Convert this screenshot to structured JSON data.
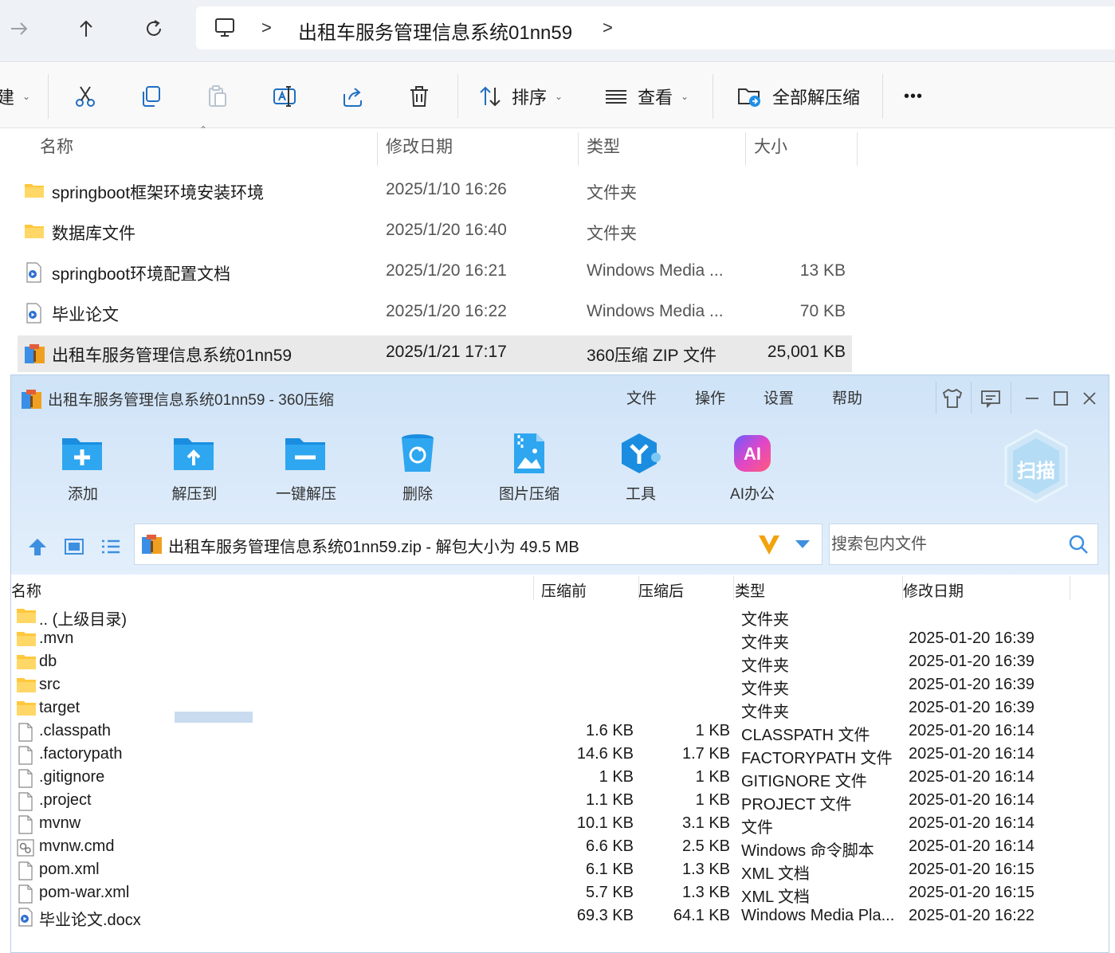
{
  "explorer": {
    "address": {
      "path": "出租车服务管理信息系统01nn59",
      "separator": ">"
    },
    "toolbar": {
      "new_fragment": "建",
      "sort_label": "排序",
      "view_label": "查看",
      "extract_all_label": "全部解压缩",
      "more_label": "•••"
    },
    "columns": {
      "name": "名称",
      "modified": "修改日期",
      "type": "类型",
      "size": "大小"
    },
    "files": [
      {
        "name": "springboot框架环境安装环境",
        "modified": "2025/1/10 16:26",
        "type": "文件夹",
        "size": "",
        "icon": "folder-icon"
      },
      {
        "name": "数据库文件",
        "modified": "2025/1/20 16:40",
        "type": "文件夹",
        "size": "",
        "icon": "folder-icon"
      },
      {
        "name": "springboot环境配置文档",
        "modified": "2025/1/20 16:21",
        "type": "Windows Media ...",
        "size": "13 KB",
        "icon": "media-doc-icon"
      },
      {
        "name": "毕业论文",
        "modified": "2025/1/20 16:22",
        "type": "Windows Media ...",
        "size": "70 KB",
        "icon": "media-doc-icon"
      },
      {
        "name": "出租车服务管理信息系统01nn59",
        "modified": "2025/1/21 17:17",
        "type": "360压缩 ZIP 文件",
        "size": "25,001 KB",
        "icon": "zip-archive-icon",
        "selected": true
      }
    ]
  },
  "zip_window": {
    "title": "出租车服务管理信息系统01nn59 - 360压缩",
    "menu": [
      "文件",
      "操作",
      "设置",
      "帮助"
    ],
    "tools": [
      {
        "label": "添加",
        "icon": "add-folder-icon"
      },
      {
        "label": "解压到",
        "icon": "extract-to-folder-icon"
      },
      {
        "label": "一键解压",
        "icon": "one-click-extract-icon"
      },
      {
        "label": "删除",
        "icon": "recycle-bin-icon"
      },
      {
        "label": "图片压缩",
        "icon": "image-compress-icon"
      },
      {
        "label": "工具",
        "icon": "tools-icon"
      },
      {
        "label": "AI办公",
        "icon": "ai-office-icon"
      }
    ],
    "scan_label": "扫描",
    "path_text": "出租车服务管理信息系统01nn59.zip - 解包大小为 49.5 MB",
    "search_placeholder": "搜索包内文件",
    "columns": {
      "name": "名称",
      "before": "压缩前",
      "after": "压缩后",
      "type": "类型",
      "modified": "修改日期"
    },
    "entries": [
      {
        "name": ".. (上级目录)",
        "before": "",
        "after": "",
        "type": "文件夹",
        "modified": "",
        "icon": "folder-icon"
      },
      {
        "name": ".mvn",
        "before": "",
        "after": "",
        "type": "文件夹",
        "modified": "2025-01-20 16:39",
        "icon": "folder-icon"
      },
      {
        "name": "db",
        "before": "",
        "after": "",
        "type": "文件夹",
        "modified": "2025-01-20 16:39",
        "icon": "folder-icon"
      },
      {
        "name": "src",
        "before": "",
        "after": "",
        "type": "文件夹",
        "modified": "2025-01-20 16:39",
        "icon": "folder-icon"
      },
      {
        "name": "target",
        "before": "",
        "after": "",
        "type": "文件夹",
        "modified": "2025-01-20 16:39",
        "icon": "folder-icon"
      },
      {
        "name": ".classpath",
        "before": "1.6 KB",
        "after": "1 KB",
        "type": "CLASSPATH 文件",
        "modified": "2025-01-20 16:14",
        "icon": "file-icon"
      },
      {
        "name": ".factorypath",
        "before": "14.6 KB",
        "after": "1.7 KB",
        "type": "FACTORYPATH 文件",
        "modified": "2025-01-20 16:14",
        "icon": "file-icon"
      },
      {
        "name": ".gitignore",
        "before": "1 KB",
        "after": "1 KB",
        "type": "GITIGNORE 文件",
        "modified": "2025-01-20 16:14",
        "icon": "file-icon"
      },
      {
        "name": ".project",
        "before": "1.1 KB",
        "after": "1 KB",
        "type": "PROJECT 文件",
        "modified": "2025-01-20 16:14",
        "icon": "file-icon"
      },
      {
        "name": "mvnw",
        "before": "10.1 KB",
        "after": "3.1 KB",
        "type": "文件",
        "modified": "2025-01-20 16:14",
        "icon": "file-icon"
      },
      {
        "name": "mvnw.cmd",
        "before": "6.6 KB",
        "after": "2.5 KB",
        "type": "Windows 命令脚本",
        "modified": "2025-01-20 16:14",
        "icon": "cmd-script-icon"
      },
      {
        "name": "pom.xml",
        "before": "6.1 KB",
        "after": "1.3 KB",
        "type": "XML 文档",
        "modified": "2025-01-20 16:15",
        "icon": "file-icon"
      },
      {
        "name": "pom-war.xml",
        "before": "5.7 KB",
        "after": "1.3 KB",
        "type": "XML 文档",
        "modified": "2025-01-20 16:15",
        "icon": "file-icon"
      },
      {
        "name": "毕业论文.docx",
        "before": "69.3 KB",
        "after": "64.1 KB",
        "type": "Windows Media Pla...",
        "modified": "2025-01-20 16:22",
        "icon": "media-doc-icon"
      }
    ]
  },
  "colors": {
    "folder": "#ffc83d",
    "accent_blue": "#1f8fe6",
    "zip_header_bg": "#d6e8f8",
    "selected_row": "#e9e9e9"
  }
}
